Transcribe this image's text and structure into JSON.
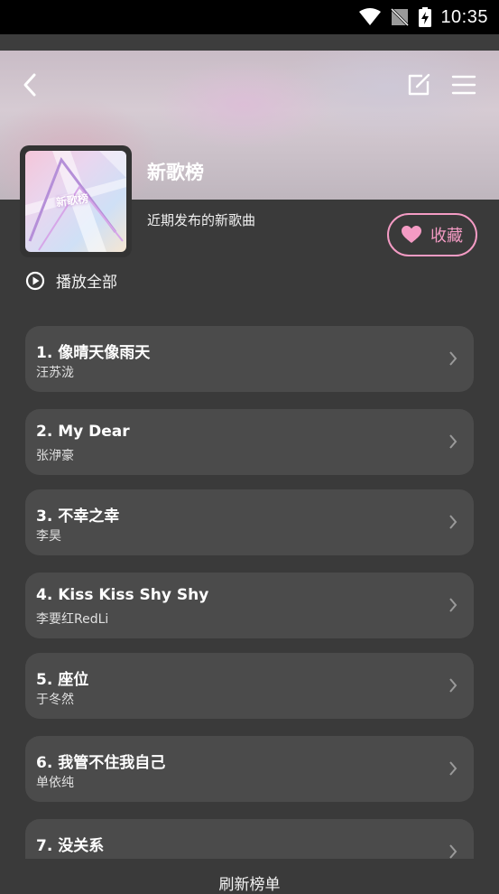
{
  "status_bar": {
    "time": "10:35"
  },
  "header": {
    "title": "新歌榜",
    "subtitle": "近期发布的新歌曲",
    "cover_text": "新歌榜",
    "favorite_label": "收藏",
    "play_all_label": "播放全部"
  },
  "songs": [
    {
      "title": "1. 像晴天像雨天",
      "artist": "汪苏泷"
    },
    {
      "title": "2. My Dear",
      "artist": "张洢豪"
    },
    {
      "title": "3. 不幸之幸",
      "artist": "李昊"
    },
    {
      "title": "4. Kiss Kiss Shy Shy",
      "artist": "李要红RedLi"
    },
    {
      "title": "5. 座位",
      "artist": "于冬然"
    },
    {
      "title": "6. 我管不住我自己",
      "artist": "单依纯"
    },
    {
      "title": "7. 没关系",
      "artist": ""
    }
  ],
  "footer": {
    "refresh_label": "刷新榜单"
  },
  "colors": {
    "accent": "#f49bc4",
    "card": "#4b4b4b",
    "background": "#3a3a3a"
  }
}
